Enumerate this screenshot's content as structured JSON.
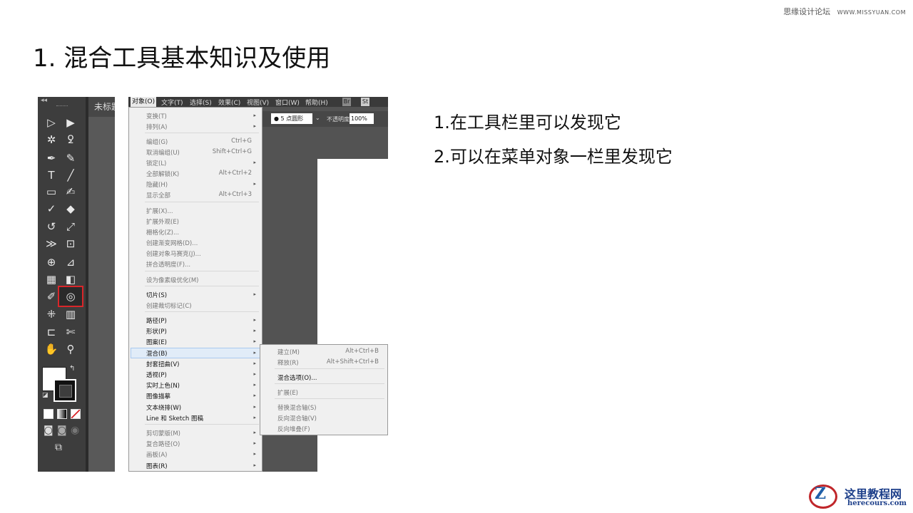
{
  "watermark": {
    "cn": "思缘设计论坛",
    "url": "WWW.MISSYUAN.COM"
  },
  "title": "1.  混合工具基本知识及使用",
  "description": {
    "line1": "1.在工具栏里可以发现它",
    "line2": "2.可以在菜单对象一栏里发现它"
  },
  "toolbar": {
    "doc_tab": "未标题",
    "collapse": "◂◂",
    "tools": [
      {
        "name": "selection-icon",
        "glyph": "▷"
      },
      {
        "name": "direct-selection-icon",
        "glyph": "▶"
      },
      {
        "name": "magic-wand-icon",
        "glyph": "✲"
      },
      {
        "name": "lasso-icon",
        "glyph": "ꝿ"
      },
      {
        "name": "pen-icon",
        "glyph": "✒"
      },
      {
        "name": "curvature-icon",
        "glyph": "✎"
      },
      {
        "name": "type-icon",
        "glyph": "T"
      },
      {
        "name": "line-icon",
        "glyph": "╱"
      },
      {
        "name": "rectangle-icon",
        "glyph": "▭"
      },
      {
        "name": "paintbrush-icon",
        "glyph": "✍"
      },
      {
        "name": "shaper-icon",
        "glyph": "✓"
      },
      {
        "name": "eraser-icon",
        "glyph": "◆"
      },
      {
        "name": "rotate-icon",
        "glyph": "↺"
      },
      {
        "name": "scale-icon",
        "glyph": "⤢"
      },
      {
        "name": "width-icon",
        "glyph": "≫"
      },
      {
        "name": "free-transform-icon",
        "glyph": "⊡"
      },
      {
        "name": "shape-builder-icon",
        "glyph": "⊕"
      },
      {
        "name": "perspective-icon",
        "glyph": "⊿"
      },
      {
        "name": "mesh-icon",
        "glyph": "▦"
      },
      {
        "name": "gradient-icon",
        "glyph": "◧"
      },
      {
        "name": "eyedropper-icon",
        "glyph": "✐"
      },
      {
        "name": "blend-icon",
        "glyph": "◎"
      },
      {
        "name": "symbol-sprayer-icon",
        "glyph": "⁜"
      },
      {
        "name": "graph-icon",
        "glyph": "▥"
      },
      {
        "name": "artboard-icon",
        "glyph": "⊏"
      },
      {
        "name": "slice-icon",
        "glyph": "✄"
      },
      {
        "name": "hand-icon",
        "glyph": "✋"
      },
      {
        "name": "zoom-icon",
        "glyph": "⚲"
      }
    ]
  },
  "menubar": {
    "items": [
      "对象(O)",
      "文字(T)",
      "选择(S)",
      "效果(C)",
      "视图(V)",
      "窗口(W)",
      "帮助(H)"
    ],
    "icon_br": "Br",
    "icon_st": "St"
  },
  "control_bar": {
    "point": "5 点圆形",
    "opacity_label": "不透明度：",
    "opacity_value": "100%"
  },
  "object_menu": {
    "items": [
      {
        "label": "变换(T)",
        "shortcut": "",
        "sub": true,
        "enabled": false
      },
      {
        "label": "排列(A)",
        "shortcut": "",
        "sub": true,
        "enabled": false
      },
      {
        "label": "编组(G)",
        "shortcut": "Ctrl+G",
        "sub": false,
        "enabled": false
      },
      {
        "label": "取消编组(U)",
        "shortcut": "Shift+Ctrl+G",
        "sub": false,
        "enabled": false
      },
      {
        "label": "锁定(L)",
        "shortcut": "",
        "sub": true,
        "enabled": false
      },
      {
        "label": "全部解锁(K)",
        "shortcut": "Alt+Ctrl+2",
        "sub": false,
        "enabled": false
      },
      {
        "label": "隐藏(H)",
        "shortcut": "",
        "sub": true,
        "enabled": false
      },
      {
        "label": "显示全部",
        "shortcut": "Alt+Ctrl+3",
        "sub": false,
        "enabled": false
      },
      {
        "label": "扩展(X)...",
        "shortcut": "",
        "sub": false,
        "enabled": false
      },
      {
        "label": "扩展外观(E)",
        "shortcut": "",
        "sub": false,
        "enabled": false
      },
      {
        "label": "栅格化(Z)...",
        "shortcut": "",
        "sub": false,
        "enabled": false
      },
      {
        "label": "创建渐变网格(D)...",
        "shortcut": "",
        "sub": false,
        "enabled": false
      },
      {
        "label": "创建对象马赛克(J)...",
        "shortcut": "",
        "sub": false,
        "enabled": false
      },
      {
        "label": "拼合透明度(F)...",
        "shortcut": "",
        "sub": false,
        "enabled": false
      },
      {
        "label": "设为像素级优化(M)",
        "shortcut": "",
        "sub": false,
        "enabled": false
      },
      {
        "label": "切片(S)",
        "shortcut": "",
        "sub": true,
        "enabled": true
      },
      {
        "label": "创建裁切标记(C)",
        "shortcut": "",
        "sub": false,
        "enabled": false
      },
      {
        "label": "路径(P)",
        "shortcut": "",
        "sub": true,
        "enabled": true
      },
      {
        "label": "形状(P)",
        "shortcut": "",
        "sub": true,
        "enabled": true
      },
      {
        "label": "图案(E)",
        "shortcut": "",
        "sub": true,
        "enabled": true
      },
      {
        "label": "混合(B)",
        "shortcut": "",
        "sub": true,
        "enabled": true
      },
      {
        "label": "封套扭曲(V)",
        "shortcut": "",
        "sub": true,
        "enabled": true
      },
      {
        "label": "透视(P)",
        "shortcut": "",
        "sub": true,
        "enabled": true
      },
      {
        "label": "实时上色(N)",
        "shortcut": "",
        "sub": true,
        "enabled": true
      },
      {
        "label": "图像描摹",
        "shortcut": "",
        "sub": true,
        "enabled": true
      },
      {
        "label": "文本绕排(W)",
        "shortcut": "",
        "sub": true,
        "enabled": true
      },
      {
        "label": "Line 和 Sketch 图稿",
        "shortcut": "",
        "sub": true,
        "enabled": true
      },
      {
        "label": "剪切蒙版(M)",
        "shortcut": "",
        "sub": true,
        "enabled": false
      },
      {
        "label": "复合路径(O)",
        "shortcut": "",
        "sub": true,
        "enabled": false
      },
      {
        "label": "画板(A)",
        "shortcut": "",
        "sub": true,
        "enabled": false
      },
      {
        "label": "图表(R)",
        "shortcut": "",
        "sub": true,
        "enabled": true
      }
    ]
  },
  "blend_submenu": {
    "items": [
      {
        "label": "建立(M)",
        "shortcut": "Alt+Ctrl+B",
        "enabled": false
      },
      {
        "label": "释放(R)",
        "shortcut": "Alt+Shift+Ctrl+B",
        "enabled": false
      },
      {
        "label": "混合选项(O)...",
        "shortcut": "",
        "enabled": true
      },
      {
        "label": "扩展(E)",
        "shortcut": "",
        "enabled": false
      },
      {
        "label": "替换混合轴(S)",
        "shortcut": "",
        "enabled": false
      },
      {
        "label": "反向混合轴(V)",
        "shortcut": "",
        "enabled": false
      },
      {
        "label": "反向堆叠(F)",
        "shortcut": "",
        "enabled": false
      }
    ]
  },
  "logo": {
    "mark": "Z",
    "cn": "这里教程网",
    "url": "herecours.com"
  },
  "colors": {
    "highlight": "#d9262a",
    "panel_dark": "#3d3d3d",
    "menu_bg": "#f0f0f0",
    "logo_blue": "#1d3f8a",
    "logo_red": "#c0262a"
  }
}
